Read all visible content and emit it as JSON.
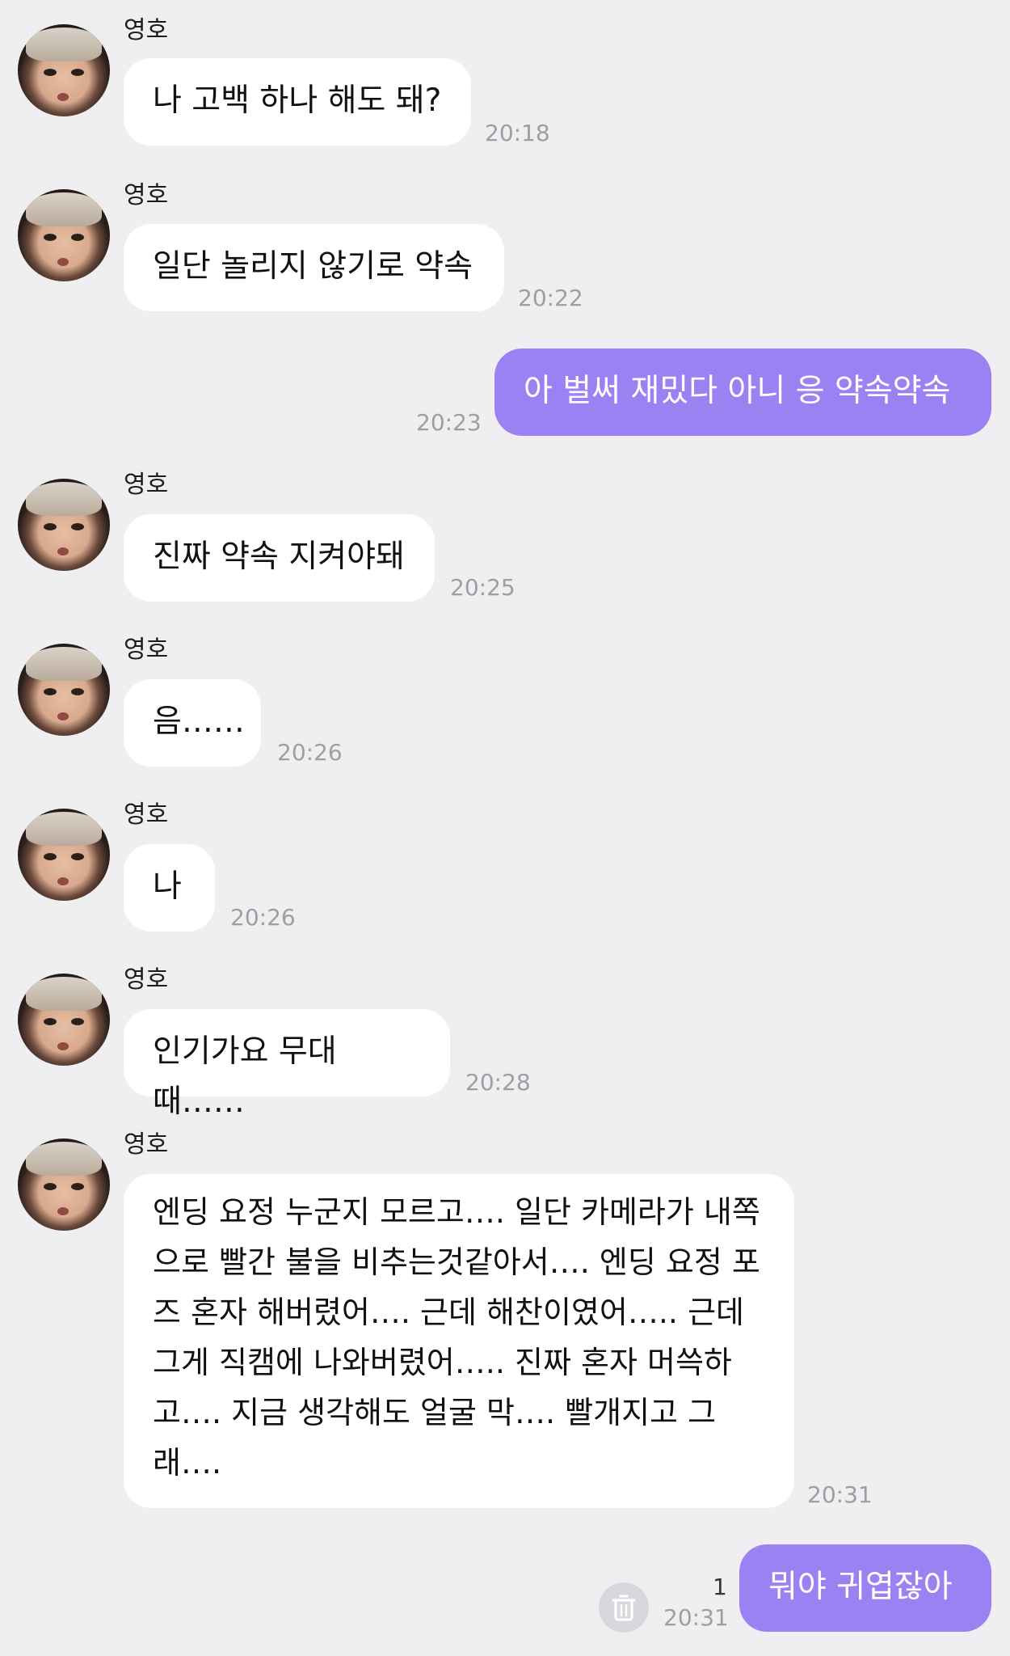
{
  "conversation": {
    "messages": [
      {
        "sender": "영호",
        "text": "나 고백 하나 해도 돼?",
        "time": "20:18",
        "direction": "incoming"
      },
      {
        "sender": "영호",
        "text": "일단 놀리지 않기로 약속",
        "time": "20:22",
        "direction": "incoming"
      },
      {
        "text": "아 벌써 재밌다 아니 응 약속약속",
        "time": "20:23",
        "direction": "outgoing"
      },
      {
        "sender": "영호",
        "text": "진짜 약속 지켜야돼",
        "time": "20:25",
        "direction": "incoming"
      },
      {
        "sender": "영호",
        "text": "음……",
        "time": "20:26",
        "direction": "incoming"
      },
      {
        "sender": "영호",
        "text": "나",
        "time": "20:26",
        "direction": "incoming"
      },
      {
        "sender": "영호",
        "text": "인기가요 무대때……",
        "time": "20:28",
        "direction": "incoming"
      },
      {
        "sender": "영호",
        "text": "엔딩 요정 누군지 모르고…. 일단 카메라가 내쪽으로 빨간 불을 비추는것같아서…. 엔딩 요정 포즈 혼자 해버렸어…. 근데 해찬이였어….. 근데 그게 직캠에 나와버렸어….. 진짜 혼자 머쓱하고…. 지금 생각해도 얼굴 막…. 빨개지고 그래….",
        "time": "20:31",
        "direction": "incoming"
      },
      {
        "text": "뭐야 귀엽잖아",
        "time": "20:31",
        "direction": "outgoing",
        "unread_count": "1",
        "action_icon": "trash-icon"
      }
    ]
  },
  "colors": {
    "background": "#efeff1",
    "incoming_bubble": "#ffffff",
    "outgoing_bubble": "#9b82f2",
    "timestamp": "#9e9ea3"
  }
}
